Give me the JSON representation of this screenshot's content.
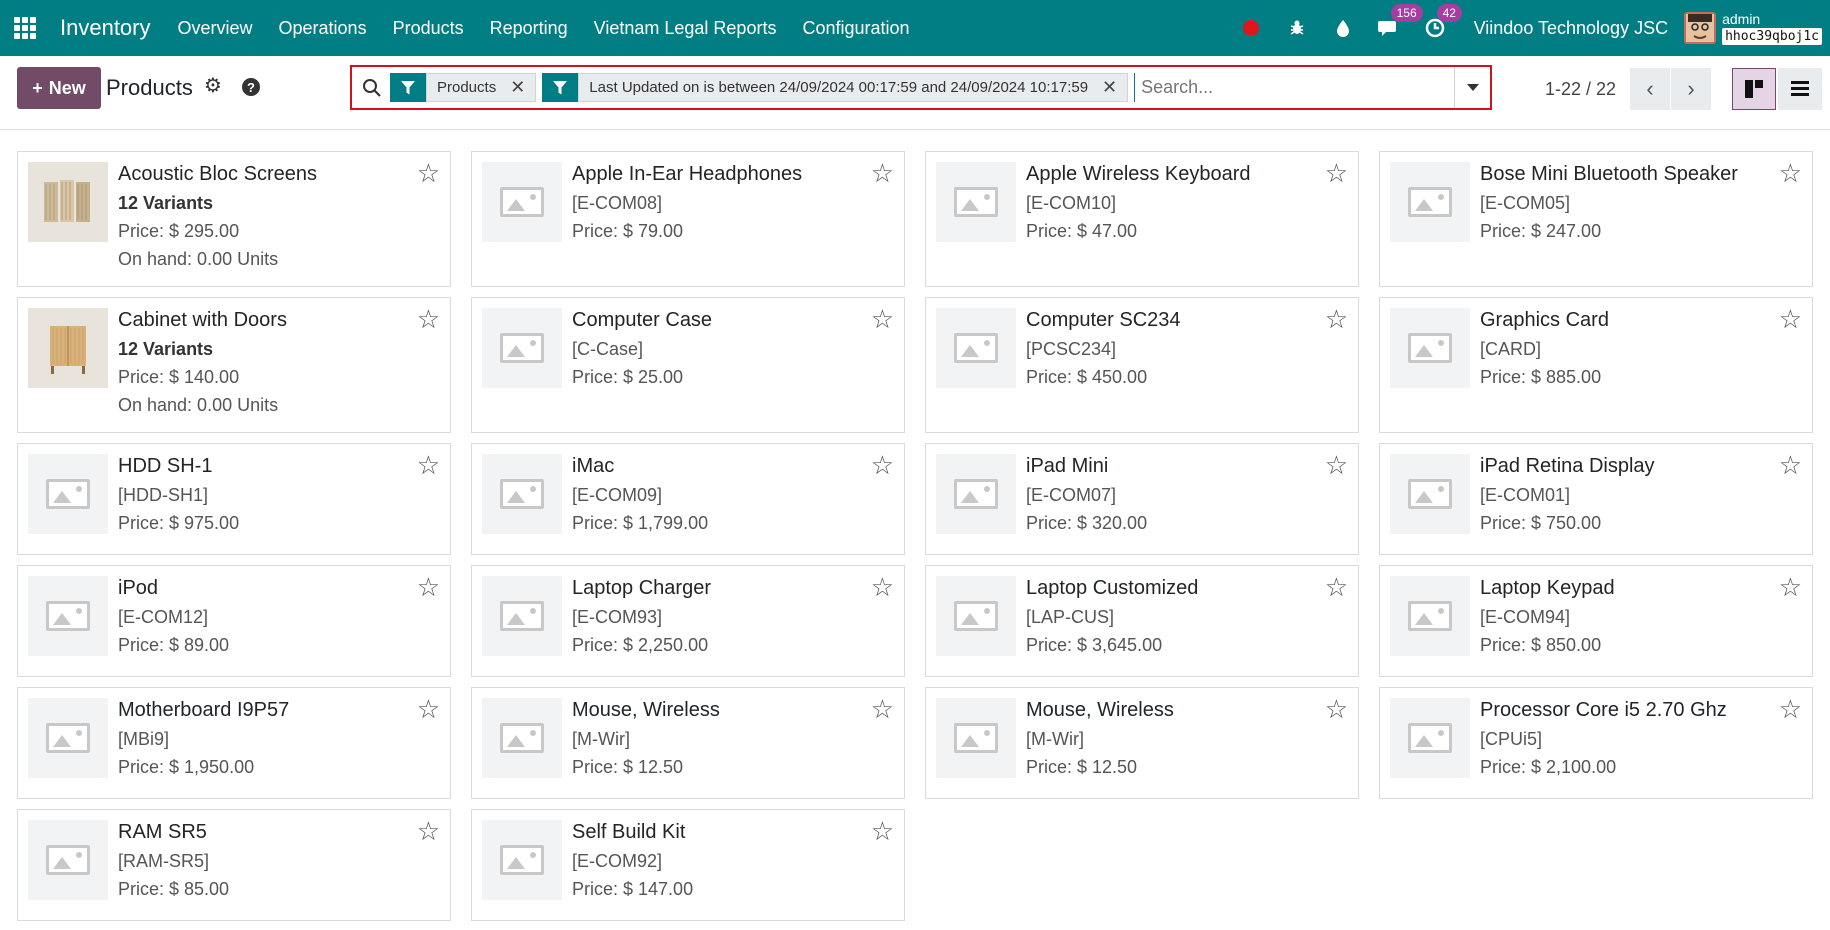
{
  "navbar": {
    "app_name": "Inventory",
    "menu": [
      "Overview",
      "Operations",
      "Products",
      "Reporting",
      "Vietnam Legal Reports",
      "Configuration"
    ],
    "chat_badge": "156",
    "activity_badge": "42",
    "company": "Viindoo Technology JSC",
    "user": "admin",
    "db": "hhoc39qboj1c"
  },
  "control": {
    "new_label": "New",
    "title": "Products",
    "facets": [
      {
        "label": "Products"
      },
      {
        "label": "Last Updated on is between 24/09/2024 00:17:59 and 24/09/2024 10:17:59"
      }
    ],
    "search_placeholder": "Search...",
    "pager": "1-22 / 22"
  },
  "colors": {
    "navbar": "#017e84",
    "primary": "#714b67",
    "highlight_border": "#d0121a"
  },
  "products": [
    {
      "name": "Acoustic Bloc Screens",
      "variants": "12 Variants",
      "price": "Price: $ 295.00",
      "onhand": "On hand: 0.00 Units",
      "image": "photo-screens"
    },
    {
      "name": "Apple In-Ear Headphones",
      "ref": "[E-COM08]",
      "price": "Price: $ 79.00"
    },
    {
      "name": "Apple Wireless Keyboard",
      "ref": "[E-COM10]",
      "price": "Price: $ 47.00"
    },
    {
      "name": "Bose Mini Bluetooth Speaker",
      "ref": "[E-COM05]",
      "price": "Price: $ 247.00"
    },
    {
      "name": "Cabinet with Doors",
      "variants": "12 Variants",
      "price": "Price: $ 140.00",
      "onhand": "On hand: 0.00 Units",
      "image": "photo-cabinet"
    },
    {
      "name": "Computer Case",
      "ref": "[C-Case]",
      "price": "Price: $ 25.00"
    },
    {
      "name": "Computer SC234",
      "ref": "[PCSC234]",
      "price": "Price: $ 450.00"
    },
    {
      "name": "Graphics Card",
      "ref": "[CARD]",
      "price": "Price: $ 885.00"
    },
    {
      "name": "HDD SH-1",
      "ref": "[HDD-SH1]",
      "price": "Price: $ 975.00"
    },
    {
      "name": "iMac",
      "ref": "[E-COM09]",
      "price": "Price: $ 1,799.00"
    },
    {
      "name": "iPad Mini",
      "ref": "[E-COM07]",
      "price": "Price: $ 320.00"
    },
    {
      "name": "iPad Retina Display",
      "ref": "[E-COM01]",
      "price": "Price: $ 750.00"
    },
    {
      "name": "iPod",
      "ref": "[E-COM12]",
      "price": "Price: $ 89.00"
    },
    {
      "name": "Laptop Charger",
      "ref": "[E-COM93]",
      "price": "Price: $ 2,250.00"
    },
    {
      "name": "Laptop Customized",
      "ref": "[LAP-CUS]",
      "price": "Price: $ 3,645.00"
    },
    {
      "name": "Laptop Keypad",
      "ref": "[E-COM94]",
      "price": "Price: $ 850.00"
    },
    {
      "name": "Motherboard I9P57",
      "ref": "[MBi9]",
      "price": "Price: $ 1,950.00"
    },
    {
      "name": "Mouse, Wireless",
      "ref": "[M-Wir]",
      "price": "Price: $ 12.50"
    },
    {
      "name": "Mouse, Wireless",
      "ref": "[M-Wir]",
      "price": "Price: $ 12.50"
    },
    {
      "name": "Processor Core i5 2.70 Ghz",
      "ref": "[CPUi5]",
      "price": "Price: $ 2,100.00"
    },
    {
      "name": "RAM SR5",
      "ref": "[RAM-SR5]",
      "price": "Price: $ 85.00"
    },
    {
      "name": "Self Build Kit",
      "ref": "[E-COM92]",
      "price": "Price: $ 147.00"
    }
  ]
}
